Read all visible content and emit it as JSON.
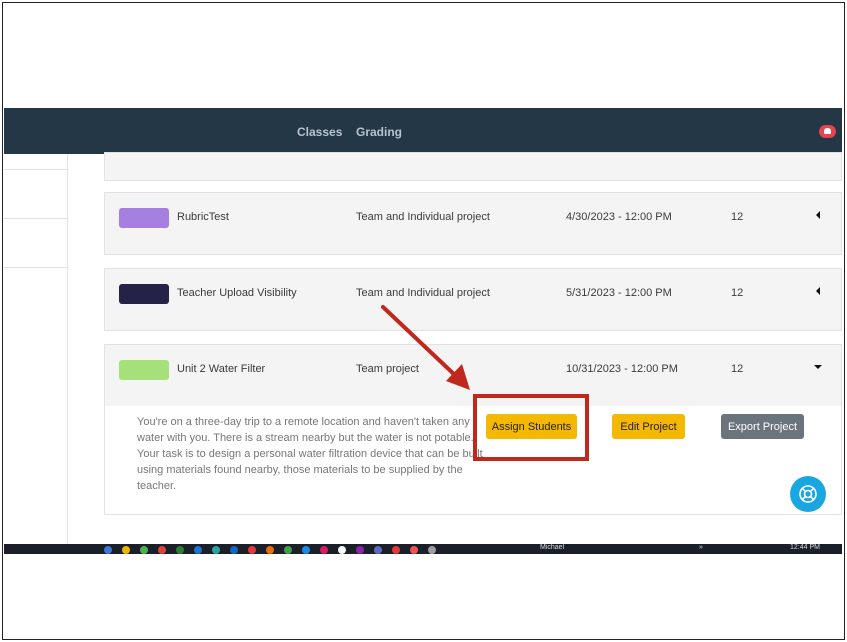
{
  "nav": {
    "links": [
      "Classes",
      "Grading"
    ]
  },
  "projects": [
    {
      "name": "RubricTest",
      "type": "Team and Individual project",
      "due": "4/30/2023 - 12:00 PM",
      "count": "12",
      "color": "#a680e0",
      "state": "collapsed"
    },
    {
      "name": "Teacher Upload Visibility",
      "type": "Team and Individual project",
      "due": "5/31/2023 - 12:00 PM",
      "count": "12",
      "color": "#242246",
      "state": "collapsed"
    },
    {
      "name": "Unit 2 Water Filter",
      "type": "Team project",
      "due": "10/31/2023 - 12:00 PM",
      "count": "12",
      "color": "#a6e07a",
      "state": "expanded"
    }
  ],
  "expanded": {
    "description": "You're on a three-day trip to a remote location and haven't taken any water with you. There is a stream nearby but the water is not potable. Your task is to design a personal water filtration device that can be built using materials found nearby, those materials to be supplied by the teacher.",
    "buttons": {
      "assign": "Assign Students",
      "edit": "Edit Project",
      "export": "Export Project"
    }
  },
  "taskbar": {
    "user": "Michael",
    "time": "12:44 PM",
    "overflow": "»"
  },
  "colors": {
    "navbar": "#243746",
    "accent_yellow": "#f5b800",
    "annotation_red": "#c0271d",
    "help_blue": "#1aa6e0"
  }
}
